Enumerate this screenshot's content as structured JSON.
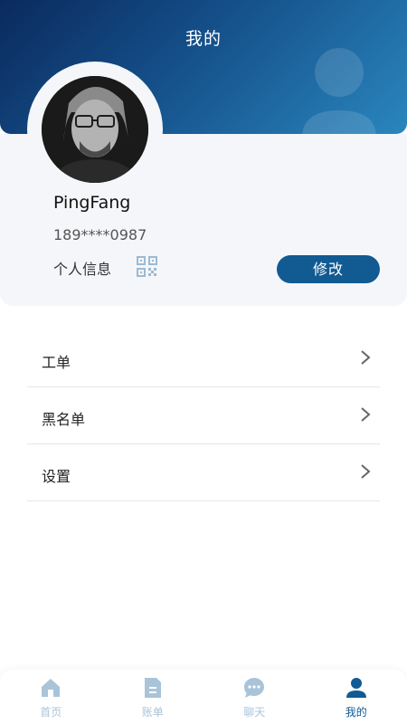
{
  "header": {
    "title": "我的"
  },
  "profile": {
    "username": "PingFang",
    "phone": "189****0987",
    "info_label": "个人信息",
    "edit_label": "修改"
  },
  "menu": {
    "items": [
      {
        "label": "工单",
        "icon": "chevron-right-icon"
      },
      {
        "label": "黑名单",
        "icon": "chevron-right-icon"
      },
      {
        "label": "设置",
        "icon": "chevron-right-icon"
      }
    ]
  },
  "tabbar": {
    "tabs": [
      {
        "label": "首页",
        "icon": "home-icon",
        "active": false
      },
      {
        "label": "账单",
        "icon": "bill-icon",
        "active": false
      },
      {
        "label": "聊天",
        "icon": "chat-icon",
        "active": false
      },
      {
        "label": "我的",
        "icon": "user-icon",
        "active": true
      }
    ]
  },
  "colors": {
    "header_gradient_start": "#0a2a5e",
    "header_gradient_end": "#2a86be",
    "accent": "#115a92",
    "tab_inactive": "#a9c4d9"
  }
}
